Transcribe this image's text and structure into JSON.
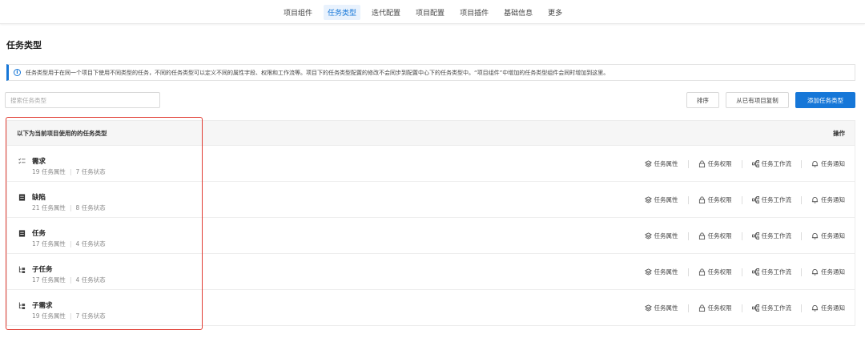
{
  "nav": {
    "tabs": [
      "项目组件",
      "任务类型",
      "迭代配置",
      "项目配置",
      "项目插件",
      "基础信息",
      "更多"
    ],
    "active_tab": "任务类型"
  },
  "page": {
    "title": "任务类型",
    "info": "任务类型用于在同一个项目下使用不同类型的任务，不同的任务类型可以定义不同的属性字段、权限和工作流等。项目下的任务类型配置的修改不会同步到配置中心下的任务类型中。“项目组件”中增加的任务类型组件会同时增加到这里。"
  },
  "search": {
    "placeholder": "搜索任务类型"
  },
  "toolbar": {
    "sort_label": "排序",
    "copy_label": "从已有项目复制",
    "add_label": "添加任务类型"
  },
  "table": {
    "header_left": "以下为当前项目使用的的任务类型",
    "header_right": "操作",
    "rows": [
      {
        "name": "需求",
        "attrs": "19 任务属性",
        "states": "7 任务状态",
        "icon": "checklist-icon"
      },
      {
        "name": "缺陷",
        "attrs": "21 任务属性",
        "states": "8 任务状态",
        "icon": "bug-doc-icon"
      },
      {
        "name": "任务",
        "attrs": "17 任务属性",
        "states": "4 任务状态",
        "icon": "task-doc-icon"
      },
      {
        "name": "子任务",
        "attrs": "17 任务属性",
        "states": "4 任务状态",
        "icon": "subtask-icon"
      },
      {
        "name": "子需求",
        "attrs": "19 任务属性",
        "states": "7 任务状态",
        "icon": "subtask-icon"
      }
    ],
    "actions": {
      "attributes": "任务属性",
      "permissions": "任务权限",
      "workflow": "任务工作流",
      "notify": "任务通知"
    }
  },
  "colors": {
    "accent": "#1677d8",
    "highlight": "#e13d33"
  }
}
